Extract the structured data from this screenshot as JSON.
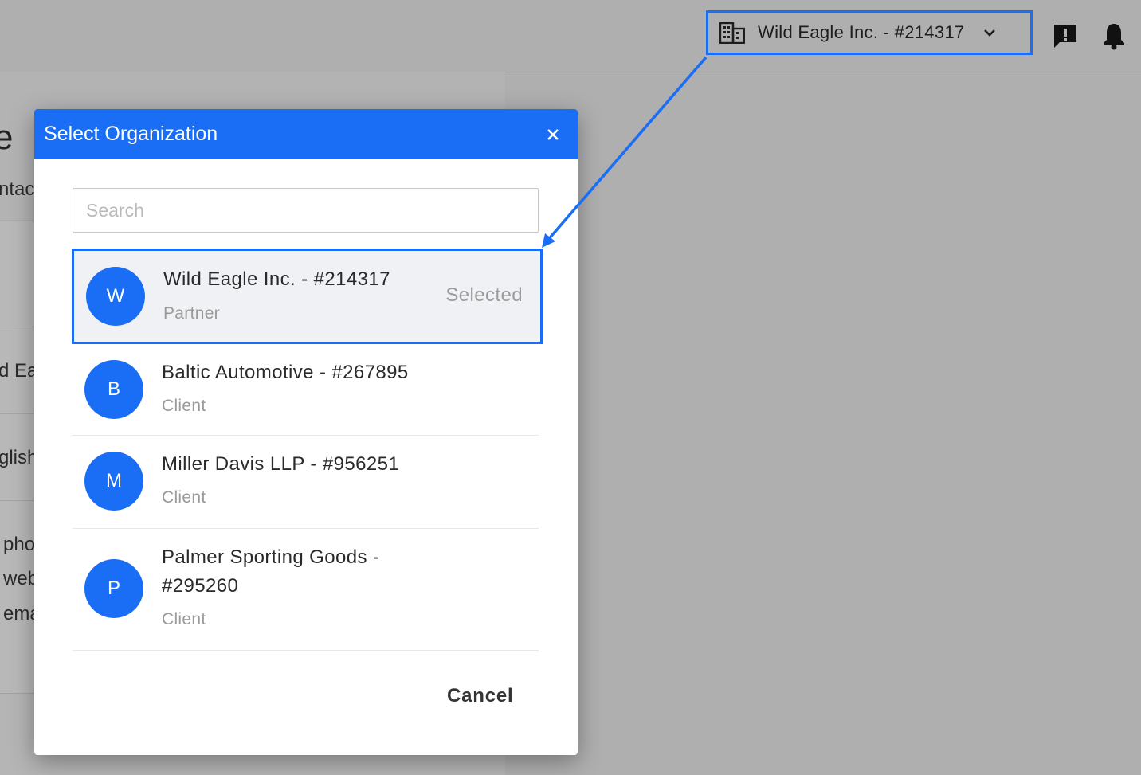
{
  "topbar": {
    "org_switcher_label": "Wild Eagle Inc. - #214317"
  },
  "background": {
    "title_fragment": "e",
    "texts": [
      "ntac",
      "d Ea",
      "glish",
      "pho",
      "web",
      "ema"
    ]
  },
  "modal": {
    "title": "Select Organization",
    "search_placeholder": "Search",
    "items": [
      {
        "initial": "W",
        "name": "Wild Eagle Inc. - #214317",
        "role": "Partner",
        "status": "Selected"
      },
      {
        "initial": "B",
        "name": "Baltic Automotive - #267895",
        "role": "Client"
      },
      {
        "initial": "M",
        "name": "Miller Davis LLP - #956251",
        "role": "Client"
      },
      {
        "initial": "P",
        "name_line1": "Palmer Sporting Goods -",
        "name_line2": "#295260",
        "role": "Client"
      }
    ],
    "cancel_label": "Cancel"
  },
  "colors": {
    "accent": "#1a6ef5",
    "overlay": "#afafaf",
    "selected_row_bg": "#eff1f4",
    "muted_text": "#9a9a9a"
  }
}
